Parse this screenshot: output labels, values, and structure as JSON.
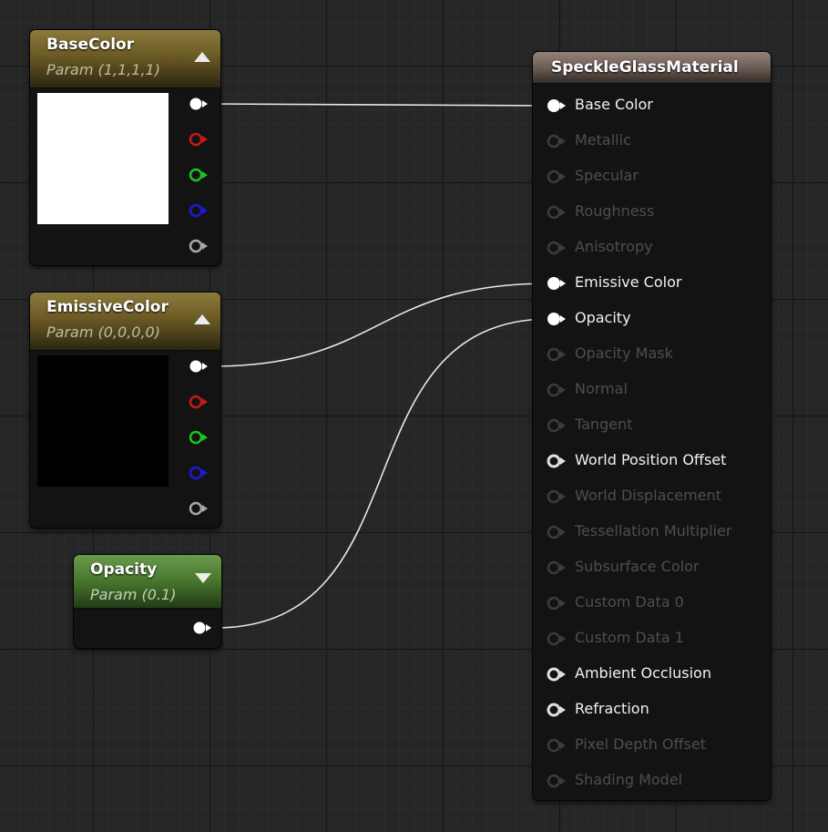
{
  "nodes": {
    "base_color": {
      "title": "BaseColor",
      "subtitle": "Param (1,1,1,1)",
      "preview_color": "#ffffff"
    },
    "emissive_color": {
      "title": "EmissiveColor",
      "subtitle": "Param (0,0,0,0)",
      "preview_color": "#000000"
    },
    "opacity": {
      "title": "Opacity",
      "subtitle": "Param (0.1)"
    }
  },
  "material": {
    "title": "SpeckleGlassMaterial",
    "inputs": [
      {
        "label": "Base Color",
        "active": true,
        "connected": true
      },
      {
        "label": "Metallic",
        "active": false,
        "connected": false
      },
      {
        "label": "Specular",
        "active": false,
        "connected": false
      },
      {
        "label": "Roughness",
        "active": false,
        "connected": false
      },
      {
        "label": "Anisotropy",
        "active": false,
        "connected": false
      },
      {
        "label": "Emissive Color",
        "active": true,
        "connected": true
      },
      {
        "label": "Opacity",
        "active": true,
        "connected": true
      },
      {
        "label": "Opacity Mask",
        "active": false,
        "connected": false
      },
      {
        "label": "Normal",
        "active": false,
        "connected": false
      },
      {
        "label": "Tangent",
        "active": false,
        "connected": false
      },
      {
        "label": "World Position Offset",
        "active": true,
        "connected": false
      },
      {
        "label": "World Displacement",
        "active": false,
        "connected": false
      },
      {
        "label": "Tessellation Multiplier",
        "active": false,
        "connected": false
      },
      {
        "label": "Subsurface Color",
        "active": false,
        "connected": false
      },
      {
        "label": "Custom Data 0",
        "active": false,
        "connected": false
      },
      {
        "label": "Custom Data 1",
        "active": false,
        "connected": false
      },
      {
        "label": "Ambient Occlusion",
        "active": true,
        "connected": false
      },
      {
        "label": "Refraction",
        "active": true,
        "connected": false
      },
      {
        "label": "Pixel Depth Offset",
        "active": false,
        "connected": false
      },
      {
        "label": "Shading Model",
        "active": false,
        "connected": false
      }
    ]
  },
  "colors": {
    "pin_red": "#c41a1a",
    "pin_green": "#1ec41e",
    "pin_blue": "#1a1ad2",
    "pin_gray": "#a8a8a8",
    "pin_white": "#ffffff",
    "wire": "#e8e8e8"
  }
}
